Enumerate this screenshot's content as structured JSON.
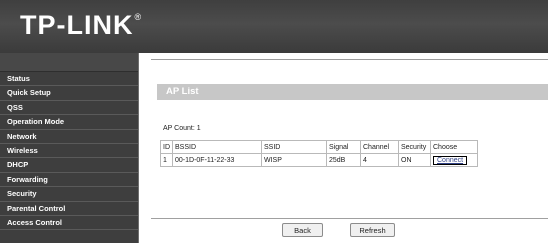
{
  "brand": {
    "name": "TP-LINK",
    "mark": "®"
  },
  "sidebar": {
    "items": [
      {
        "label": "Status"
      },
      {
        "label": "Quick Setup"
      },
      {
        "label": "QSS"
      },
      {
        "label": "Operation Mode"
      },
      {
        "label": "Network"
      },
      {
        "label": "Wireless"
      },
      {
        "label": "DHCP"
      },
      {
        "label": "Forwarding"
      },
      {
        "label": "Security"
      },
      {
        "label": "Parental Control"
      },
      {
        "label": "Access Control"
      }
    ]
  },
  "main": {
    "title": "AP List",
    "ap_count_label": "AP Count:",
    "ap_count_value": "1",
    "table": {
      "headers": [
        "ID",
        "BSSID",
        "SSID",
        "Signal",
        "Channel",
        "Security",
        "Choose"
      ],
      "rows": [
        {
          "id": "1",
          "bssid": "00-1D-0F-11-22-33",
          "ssid": "WISP",
          "signal": "25dB",
          "channel": "4",
          "security": "ON",
          "choose": "Connect"
        }
      ]
    },
    "buttons": {
      "back": "Back",
      "refresh": "Refresh"
    }
  }
}
